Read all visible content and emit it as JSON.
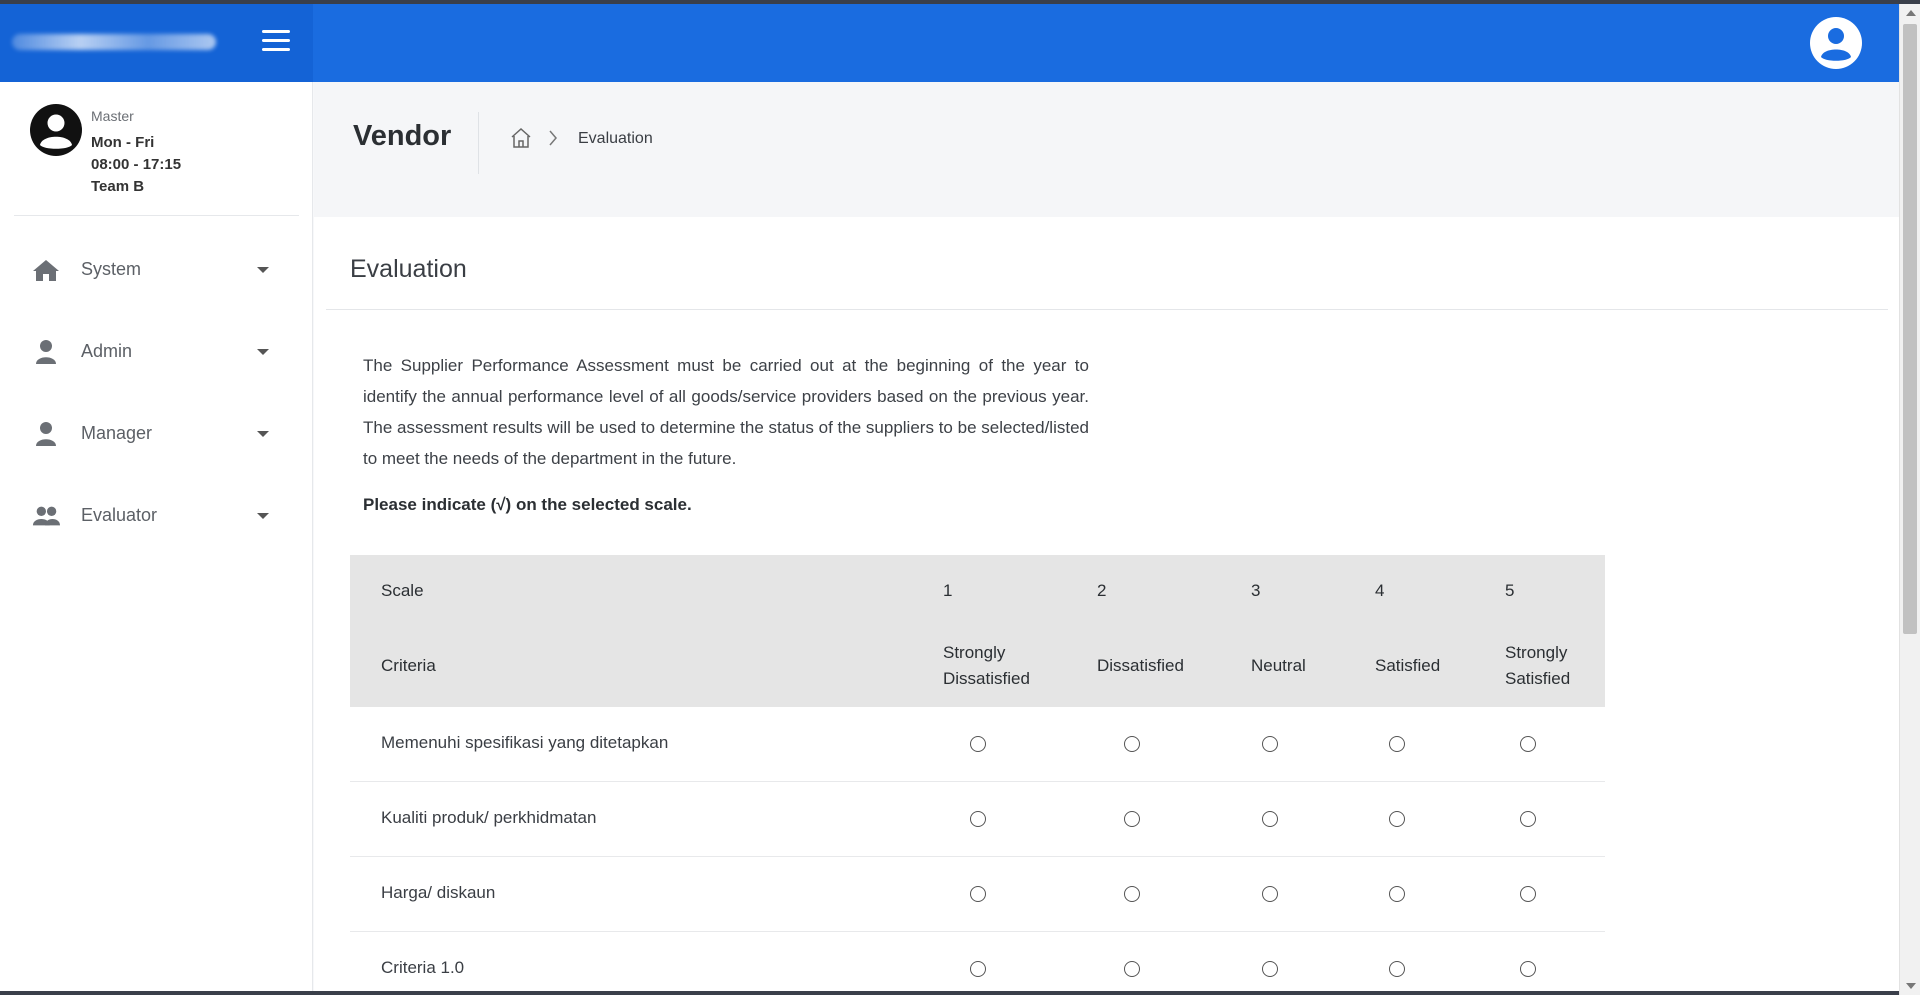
{
  "colors": {
    "topbar": "#1a6ce0",
    "brand_area": "#1463d6",
    "table_header": "#e5e5e5"
  },
  "header": {
    "menu_icon": "hamburger-icon",
    "user_icon": "user-circle-icon"
  },
  "profile": {
    "role": "Master",
    "days": "Mon - Fri",
    "hours": "08:00 - 17:15",
    "team": "Team B"
  },
  "sidebar": {
    "items": [
      {
        "label": "System",
        "icon": "home-icon"
      },
      {
        "label": "Admin",
        "icon": "user-icon"
      },
      {
        "label": "Manager",
        "icon": "user-icon"
      },
      {
        "label": "Evaluator",
        "icon": "users-icon"
      }
    ]
  },
  "page": {
    "title": "Vendor",
    "breadcrumb": {
      "home_icon": "home-outline-icon",
      "current": "Evaluation"
    }
  },
  "card": {
    "title": "Evaluation",
    "intro": "The Supplier Performance Assessment must be carried out at the beginning of the year to identify the annual performance level of all goods/service providers based on the previous year. The assessment results will be used to determine the status of the suppliers to be selected/listed to meet the needs of the department in the future.",
    "instruction": "Please indicate (√) on the selected scale."
  },
  "table": {
    "scale_label": "Scale",
    "criteria_label": "Criteria",
    "scale_numbers": [
      "1",
      "2",
      "3",
      "4",
      "5"
    ],
    "scale_names": [
      [
        "Strongly",
        "Dissatisfied"
      ],
      [
        "Dissatisfied"
      ],
      [
        "Neutral"
      ],
      [
        "Satisfied"
      ],
      [
        "Strongly",
        "Satisfied"
      ]
    ],
    "rows": [
      "Memenuhi spesifikasi yang ditetapkan",
      "Kualiti produk/ perkhidmatan",
      "Harga/ diskaun",
      "Criteria 1.0"
    ]
  }
}
